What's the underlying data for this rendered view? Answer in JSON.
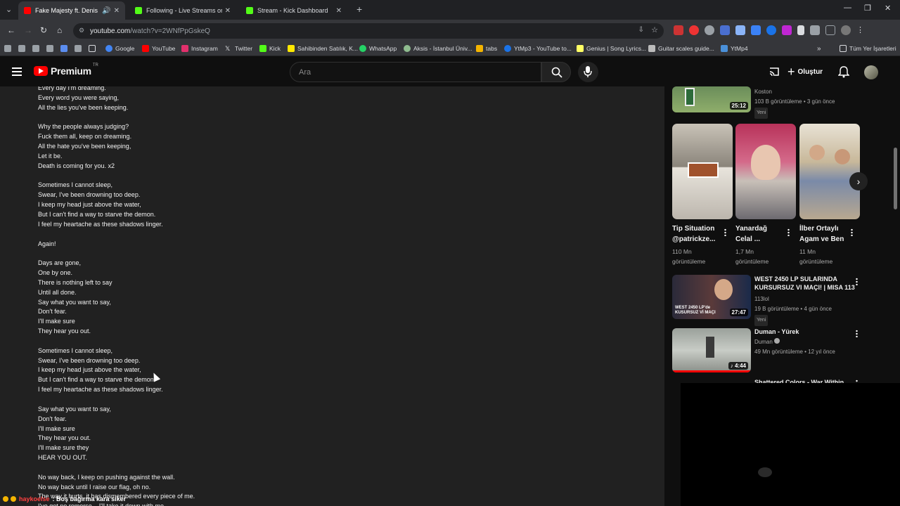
{
  "browser": {
    "tabs": [
      {
        "title": "Fake Majesty ft. Denis Stoff",
        "active": true,
        "color": "#ff0000"
      },
      {
        "title": "Following - Live Streams on Kick",
        "active": false,
        "color": "#53fc18"
      },
      {
        "title": "Stream - Kick Dashboard",
        "active": false,
        "color": "#53fc18"
      }
    ],
    "url_domain": "youtube.com",
    "url_path": "/watch?v=2WNfPpGskeQ",
    "bookmarks": [
      {
        "label": "Google",
        "color": "#4285f4"
      },
      {
        "label": "YouTube",
        "color": "#ff0000"
      },
      {
        "label": "Instagram",
        "color": "#e1306c"
      },
      {
        "label": "Twitter",
        "color": "#e8eaed"
      },
      {
        "label": "Kick",
        "color": "#53fc18"
      },
      {
        "label": "Sahibinden Satılık, K...",
        "color": "#ffe800"
      },
      {
        "label": "WhatsApp",
        "color": "#25d366"
      },
      {
        "label": "Aksis - İstanbul Üniv...",
        "color": "#8fbc8f"
      },
      {
        "label": "tabs",
        "color": "#f4b400"
      },
      {
        "label": "YtMp3 - YouTube to...",
        "color": "#1a73e8"
      },
      {
        "label": "Genius | Song Lyrics...",
        "color": "#ffff64"
      },
      {
        "label": "Guitar scales guide...",
        "color": "#bbbbbb"
      },
      {
        "label": "YtMp4",
        "color": "#4a90d9"
      }
    ],
    "other_bookmarks": "Tüm Yer İşaretleri"
  },
  "youtube": {
    "logo_text": "Premium",
    "logo_sup": "TR",
    "search_placeholder": "Ara",
    "create_label": "Oluştur"
  },
  "lyrics": "Every day I'm dreaming.\nEvery word you were saying,\nAll the lies you've been keeping.\n\nWhy the people always judging?\nFuck them all, keep on dreaming.\nAll the hate you've been keeping,\nLet it be.\nDeath is coming for you. x2\n\nSometimes I cannot sleep,\nSwear, I've been drowning too deep.\nI keep my head just above the water,\nBut I can't find a way to starve the demon.\nI feel my heartache as these shadows linger.\n\nAgain!\n\nDays are gone,\nOne by one.\nThere is nothing left to say\nUntil all done.\nSay what you want to say,\nDon't fear.\nI'll make sure\nThey hear you out.\n\nSometimes I cannot sleep,\nSwear, I've been drowning too deep.\nI keep my head just above the water,\nBut I can't find a way to starve the demon.\nI feel my heartache as these shadows linger.\n\nSay what you want to say,\nDon't fear.\nI'll make sure\nThey hear you out.\nI'll make sure they\nHEAR YOU OUT.\n\nNo way back, I keep on pushing against the wall.\nNo way back until I raise our flag, oh no.\nThe way it hurts, it has dismembered every piece of me.\nI've got no remorse... I'll take it down with me.",
  "sidebar": {
    "top_video": {
      "channel": "Koston",
      "meta": "103 B görüntüleme • 3 gün önce",
      "badge": "Yeni",
      "duration": "25:12"
    },
    "shorts": [
      {
        "title": "Tip Situation @patrickze...",
        "views": "110 Mn",
        "views_label": "görüntüleme"
      },
      {
        "title": "Yanardağ Celal ...",
        "views": "1,7 Mn",
        "views_label": "görüntüleme"
      },
      {
        "title": "İlber Ortaylı Agam ve Ben",
        "views": "11 Mn",
        "views_label": "görüntüleme"
      }
    ],
    "videos": [
      {
        "title": "WEST 2450 LP SULARINDA KURSURSUZ VI MAÇI! | MISA 113",
        "channel": "113lol",
        "meta": "19 B görüntüleme • 4 gün önce",
        "badge": "Yeni",
        "duration": "27:47",
        "thumb_text": "WEST 2450 LP'de KUSURSUZ Vİ MAÇI"
      },
      {
        "title": "Duman - Yürek",
        "channel": "Duman",
        "meta": "49 Mn görüntüleme • 12 yıl önce",
        "duration": "4:44"
      },
      {
        "title": "Shattered Colors - War Within"
      }
    ]
  },
  "taskbar": {
    "user": "haykoelse",
    "text": ": Boş bağırma kara siker"
  }
}
